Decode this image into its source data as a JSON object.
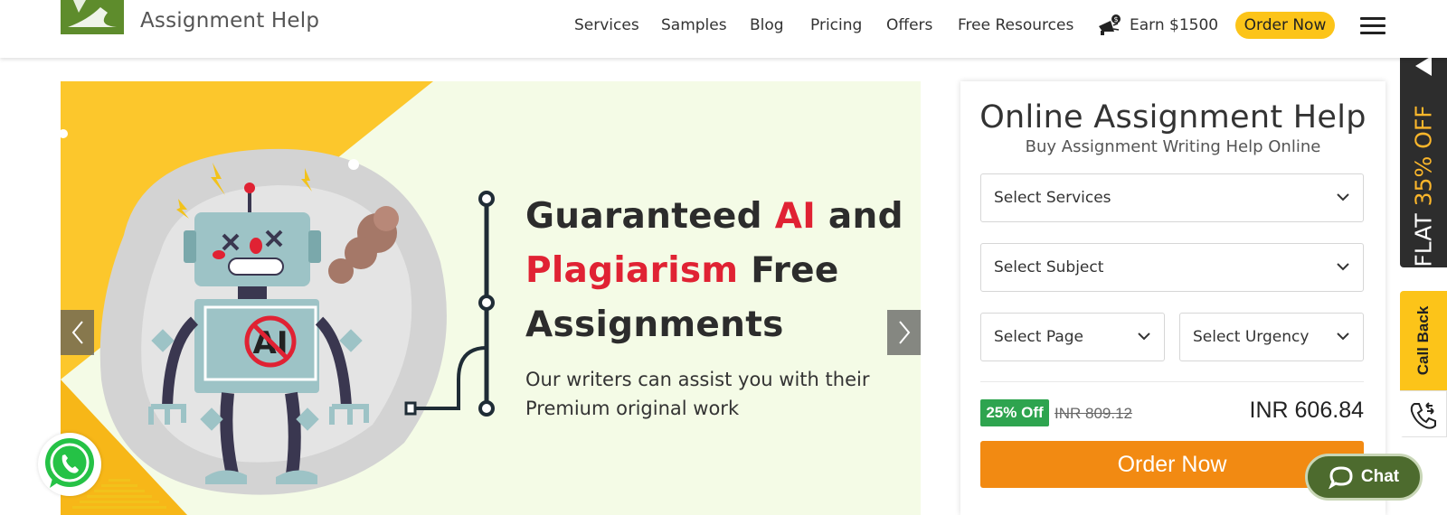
{
  "header": {
    "logo_text": "Assignment Help",
    "nav": [
      "Services",
      "Samples",
      "Blog",
      "Pricing",
      "Offers",
      "Free Resources"
    ],
    "earn_label": "Earn $1500",
    "order_button": "Order Now",
    "colors": {
      "accent": "#fcc419",
      "logo_green": "#5e8c2c"
    }
  },
  "hero": {
    "line1_a": "Guaranteed ",
    "line1_b": "AI",
    "line1_c": " and",
    "line2_a": "Plagiarism",
    "line2_b": " Free",
    "line3": "Assignments",
    "subtitle": "Our writers can assist you with their Premium original work",
    "colors": {
      "highlight": "#e02233",
      "background": "#f4fbe6",
      "corner": "#fcc72c"
    }
  },
  "form": {
    "title": "Online Assignment Help",
    "subtitle": "Buy Assignment Writing Help Online",
    "select_services": "Select Services",
    "select_subject": "Select Subject",
    "select_page": "Select Page",
    "select_urgency": "Select Urgency",
    "discount_badge": "25% Off",
    "old_price": "INR 809.12",
    "new_price": "INR 606.84",
    "order_button": "Order Now"
  },
  "side": {
    "flat_prefix": "FLAT ",
    "flat_highlight": "35% OFF",
    "callback": "Call Back"
  },
  "chat_label": "Chat",
  "icons": [
    "logo-icon",
    "megaphone-icon",
    "hamburger-icon",
    "chevron-left-icon",
    "chevron-right-icon",
    "chevron-down-icon",
    "triangle-left-icon",
    "phone-icon",
    "whatsapp-icon",
    "chat-bubble-icon"
  ]
}
